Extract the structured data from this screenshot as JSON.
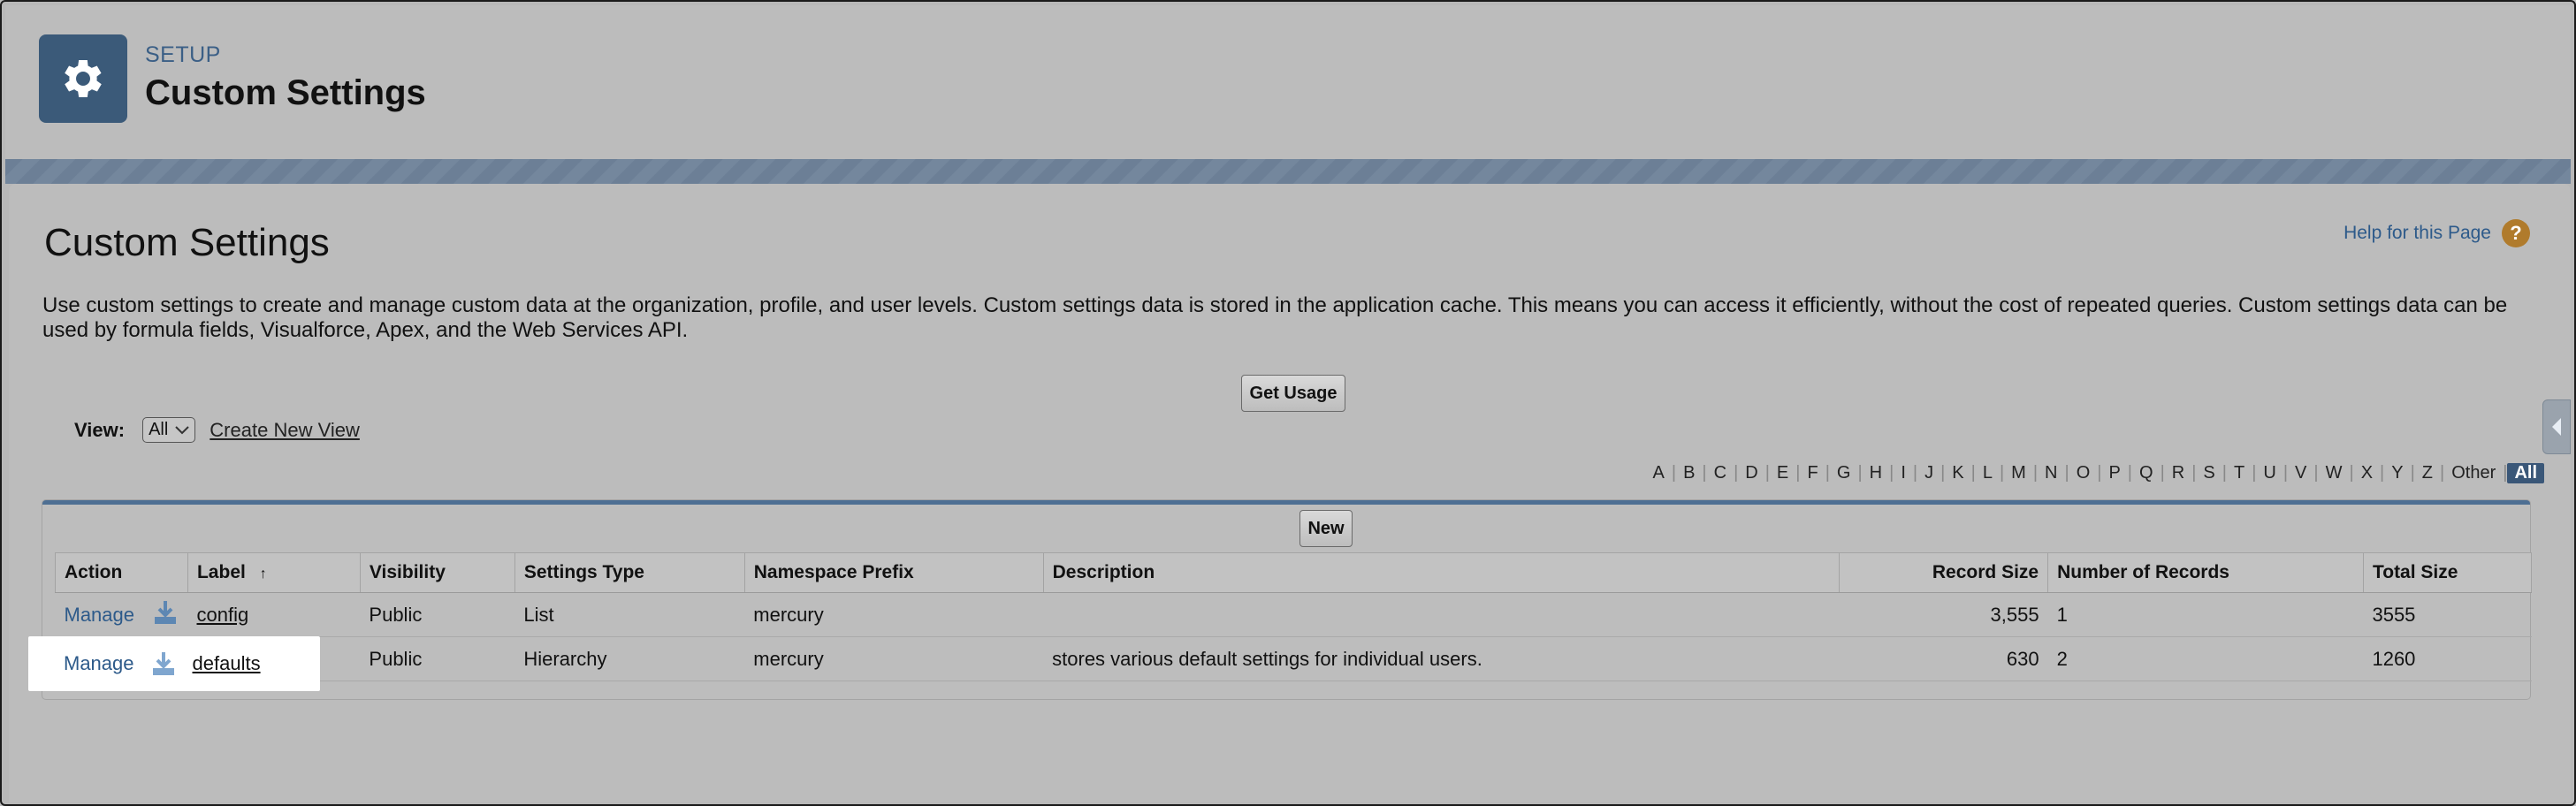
{
  "header": {
    "kicker": "SETUP",
    "title": "Custom Settings"
  },
  "page": {
    "title": "Custom Settings",
    "help_link": "Help for this Page",
    "description": "Use custom settings to create and manage custom data at the organization, profile, and user levels. Custom settings data is stored in the application cache. This means you can access it efficiently, without the cost of repeated queries. Custom settings data can be used by formula fields, Visualforce, Apex, and the Web Services API."
  },
  "toolbar": {
    "get_usage": "Get Usage",
    "view_label": "View:",
    "view_selected": "All",
    "create_view": "Create New View",
    "new_button": "New"
  },
  "alpha": [
    "A",
    "B",
    "C",
    "D",
    "E",
    "F",
    "G",
    "H",
    "I",
    "J",
    "K",
    "L",
    "M",
    "N",
    "O",
    "P",
    "Q",
    "R",
    "S",
    "T",
    "U",
    "V",
    "W",
    "X",
    "Y",
    "Z",
    "Other",
    "All"
  ],
  "alpha_active": "All",
  "table": {
    "columns": [
      "Action",
      "Label",
      "Visibility",
      "Settings Type",
      "Namespace Prefix",
      "Description",
      "Record Size",
      "Number of Records",
      "Total Size"
    ],
    "rows": [
      {
        "action": "Manage",
        "label": "config",
        "visibility": "Public",
        "type": "List",
        "namespace": "mercury",
        "description": "",
        "record_size": "3,555",
        "num_records": "1",
        "total_size": "3555"
      },
      {
        "action": "Manage",
        "label": "defaults",
        "visibility": "Public",
        "type": "Hierarchy",
        "namespace": "mercury",
        "description": "stores various default settings for individual users.",
        "record_size": "630",
        "num_records": "2",
        "total_size": "1260"
      }
    ]
  },
  "colors": {
    "brand": "#3b5a79",
    "link": "#2d5a8a",
    "help": "#b07b2c"
  }
}
